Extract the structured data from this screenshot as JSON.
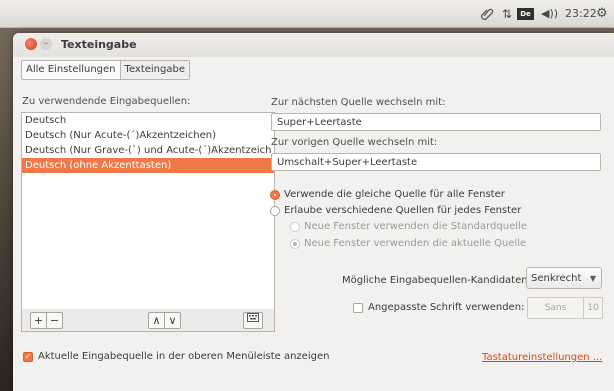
{
  "panel": {
    "clock": "23:22",
    "keyboard_indicator": "De",
    "icons": [
      "paperclip-icon",
      "network-icon",
      "keyboard-layout-icon",
      "volume-icon",
      "gear-icon"
    ]
  },
  "window": {
    "title": "Texteingabe"
  },
  "breadcrumb": {
    "items": [
      {
        "label": "Alle Einstellungen"
      },
      {
        "label": "Texteingabe"
      }
    ]
  },
  "sources": {
    "label": "Zu verwendende Eingabequellen:",
    "items": [
      {
        "label": "Deutsch",
        "selected": false
      },
      {
        "label": "Deutsch (Nur Acute-(´)Akzentzeichen)",
        "selected": false
      },
      {
        "label": "Deutsch (Nur Grave-(`) und Acute-(´)Akzentzeich",
        "selected": false
      },
      {
        "label": "Deutsch (ohne Akzenttasten)",
        "selected": true
      }
    ],
    "toolbar": {
      "add": "+",
      "remove": "−",
      "up": "∧",
      "down": "∨"
    }
  },
  "shortcuts": {
    "next_label": "Zur nächsten Quelle wechseln mit:",
    "next_value": "Super+Leertaste",
    "prev_label": "Zur vorigen Quelle wechseln mit:",
    "prev_value": "Umschalt+Super+Leertaste"
  },
  "options": {
    "same_source": "Verwende die gleiche Quelle für alle Fenster",
    "different_sources": "Erlaube verschiedene Quellen für jedes Fenster",
    "new_windows_default": "Neue Fenster verwenden die Standardquelle",
    "new_windows_current": "Neue Fenster verwenden die aktuelle Quelle",
    "selected": "same_source"
  },
  "candidates": {
    "label": "Mögliche Eingabequellen-Kandidaten:",
    "value": "Senkrecht"
  },
  "custom_font": {
    "label": "Angepasste Schrift verwenden:",
    "checked": false,
    "font_name": "Sans",
    "font_size": "10"
  },
  "footer": {
    "show_in_menubar": "Aktuelle Eingabequelle in der oberen Menüleiste anzeigen",
    "show_in_menubar_checked": true,
    "keyboard_settings_link": "Tastatureinstellungen ..."
  },
  "colors": {
    "accent": "#f07746",
    "link": "#dd4814"
  }
}
